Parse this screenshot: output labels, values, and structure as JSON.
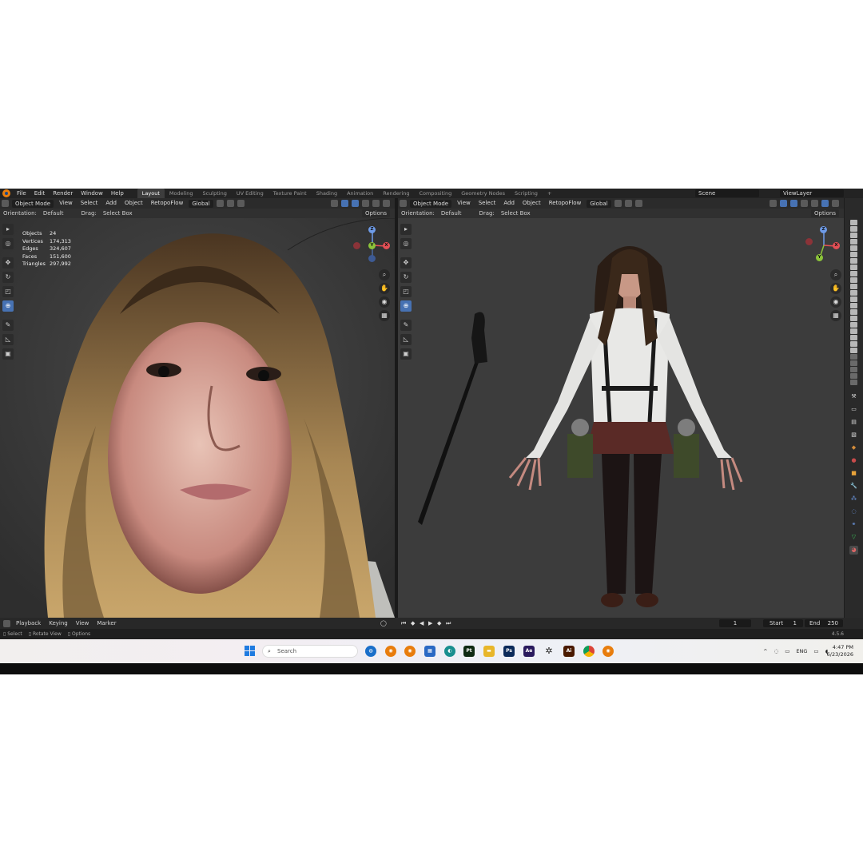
{
  "topbar": {
    "menus": [
      "File",
      "Edit",
      "Render",
      "Window",
      "Help"
    ],
    "workspaces": [
      "Layout",
      "Modeling",
      "Sculpting",
      "UV Editing",
      "Texture Paint",
      "Shading",
      "Animation",
      "Rendering",
      "Compositing",
      "Geometry Nodes",
      "Scripting"
    ],
    "active_workspace": "Layout",
    "add_tab": "+",
    "scene": "Scene",
    "view_layer": "ViewLayer"
  },
  "viewport_left": {
    "mode": "Object Mode",
    "menus": [
      "View",
      "Select",
      "Add",
      "Object"
    ],
    "addon": "RetopoFlow",
    "transform": "Global",
    "orientation_label": "Orientation:",
    "orientation_value": "Default",
    "drag_label": "Drag:",
    "drag_value": "Select Box",
    "options": "Options",
    "stats": [
      {
        "label": "Objects",
        "value": "24"
      },
      {
        "label": "Vertices",
        "value": "174,313"
      },
      {
        "label": "Edges",
        "value": "324,607"
      },
      {
        "label": "Faces",
        "value": "151,600"
      },
      {
        "label": "Triangles",
        "value": "297,992"
      }
    ]
  },
  "viewport_right": {
    "mode": "Object Mode",
    "menus": [
      "View",
      "Select",
      "Add",
      "Object"
    ],
    "addon": "RetopoFlow",
    "transform": "Global",
    "orientation_label": "Orientation:",
    "orientation_value": "Default",
    "drag_label": "Drag:",
    "drag_value": "Select Box",
    "options": "Options"
  },
  "gizmo": {
    "x": "X",
    "y": "Y",
    "z": "Z"
  },
  "timeline": {
    "menus": [
      "Playback",
      "Keying",
      "View",
      "Marker"
    ],
    "current_frame": "1",
    "start_label": "Start",
    "start_value": "1",
    "end_label": "End",
    "end_value": "250"
  },
  "statusbar": {
    "select": "Select",
    "rotate": "Rotate View",
    "options": "Options",
    "version": "4.5.6"
  },
  "taskbar": {
    "search_placeholder": "Search",
    "apps": [
      {
        "name": "ps",
        "label": "Ps",
        "color": "#0b2a5a"
      },
      {
        "name": "ae",
        "label": "Ae",
        "color": "#2a1a5e"
      },
      {
        "name": "ai",
        "label": "Ai",
        "color": "#4a1a00"
      },
      {
        "name": "pt",
        "label": "Pt",
        "color": "#0f2a12"
      }
    ],
    "language": "ENG",
    "time": "4:47 PM",
    "date": "6/23/2026"
  }
}
